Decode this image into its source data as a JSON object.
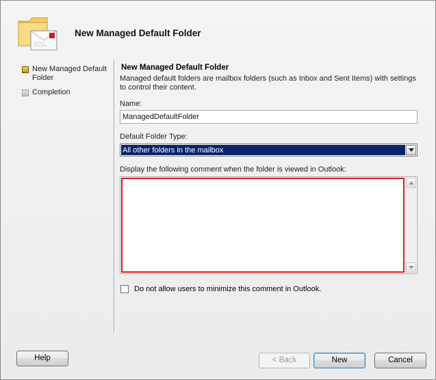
{
  "window": {
    "title": "New Managed Default Folder",
    "header_icon": "folder-mail-icon"
  },
  "nav": {
    "items": [
      {
        "label": "New Managed Default Folder",
        "state": "active"
      },
      {
        "label": "Completion",
        "state": "pending"
      }
    ]
  },
  "section": {
    "title": "New Managed Default Folder",
    "description": "Managed default folders are mailbox folders (such as Inbox and Sent Items) with settings to control their content."
  },
  "form": {
    "name_label": "Name:",
    "name_value": "ManagedDefaultFolder",
    "folder_type_label": "Default Folder Type:",
    "folder_type_value": "All other folders in the mailbox",
    "comment_label": "Display the following comment when the folder is viewed in Outlook:",
    "comment_value": "",
    "checkbox_label": "Do not allow users to minimize this comment in Outlook.",
    "checkbox_checked": false
  },
  "buttons": {
    "help": "Help",
    "back": "< Back",
    "new": "New",
    "cancel": "Cancel"
  },
  "colors": {
    "selection": "#0a246a",
    "validation_border": "#d81b1b"
  }
}
